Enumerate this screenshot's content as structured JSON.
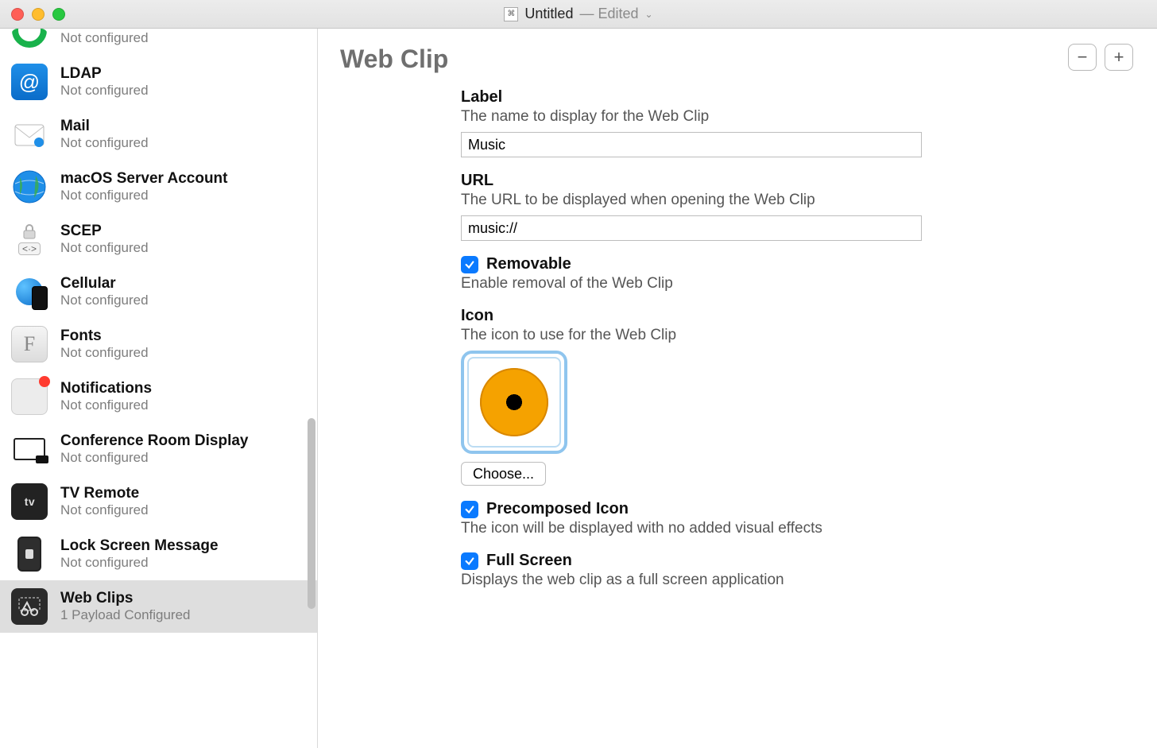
{
  "window": {
    "title": "Untitled",
    "state": "— Edited"
  },
  "sidebar": {
    "not_configured": "Not configured",
    "items": [
      {
        "title": "",
        "sub": "Not configured",
        "icon": "green-ring"
      },
      {
        "title": "LDAP",
        "sub": "Not configured",
        "icon": "ldap"
      },
      {
        "title": "Mail",
        "sub": "Not configured",
        "icon": "mail"
      },
      {
        "title": "macOS Server Account",
        "sub": "Not configured",
        "icon": "globe"
      },
      {
        "title": "SCEP",
        "sub": "Not configured",
        "icon": "scep"
      },
      {
        "title": "Cellular",
        "sub": "Not configured",
        "icon": "cellular"
      },
      {
        "title": "Fonts",
        "sub": "Not configured",
        "icon": "fonts"
      },
      {
        "title": "Notifications",
        "sub": "Not configured",
        "icon": "notifications"
      },
      {
        "title": "Conference Room Display",
        "sub": "Not configured",
        "icon": "confroom"
      },
      {
        "title": "TV Remote",
        "sub": "Not configured",
        "icon": "tvremote"
      },
      {
        "title": "Lock Screen Message",
        "sub": "Not configured",
        "icon": "lockscreen"
      },
      {
        "title": "Web Clips",
        "sub": "1 Payload Configured",
        "icon": "webclips",
        "selected": true
      }
    ]
  },
  "content": {
    "title": "Web Clip",
    "remove_payload": "−",
    "add_payload": "+",
    "label_field": {
      "label": "Label",
      "desc": "The name to display for the Web Clip",
      "value": "Music"
    },
    "url_field": {
      "label": "URL",
      "desc": "The URL to be displayed when opening the Web Clip",
      "value": "music://"
    },
    "removable": {
      "label": "Removable",
      "desc": "Enable removal of the Web Clip",
      "checked": true
    },
    "icon_field": {
      "label": "Icon",
      "desc": "The icon to use for the Web Clip",
      "choose": "Choose..."
    },
    "precomposed": {
      "label": "Precomposed Icon",
      "desc": "The icon will be displayed with no added visual effects",
      "checked": true
    },
    "fullscreen": {
      "label": "Full Screen",
      "desc": "Displays the web clip as a full screen application",
      "checked": true
    }
  }
}
